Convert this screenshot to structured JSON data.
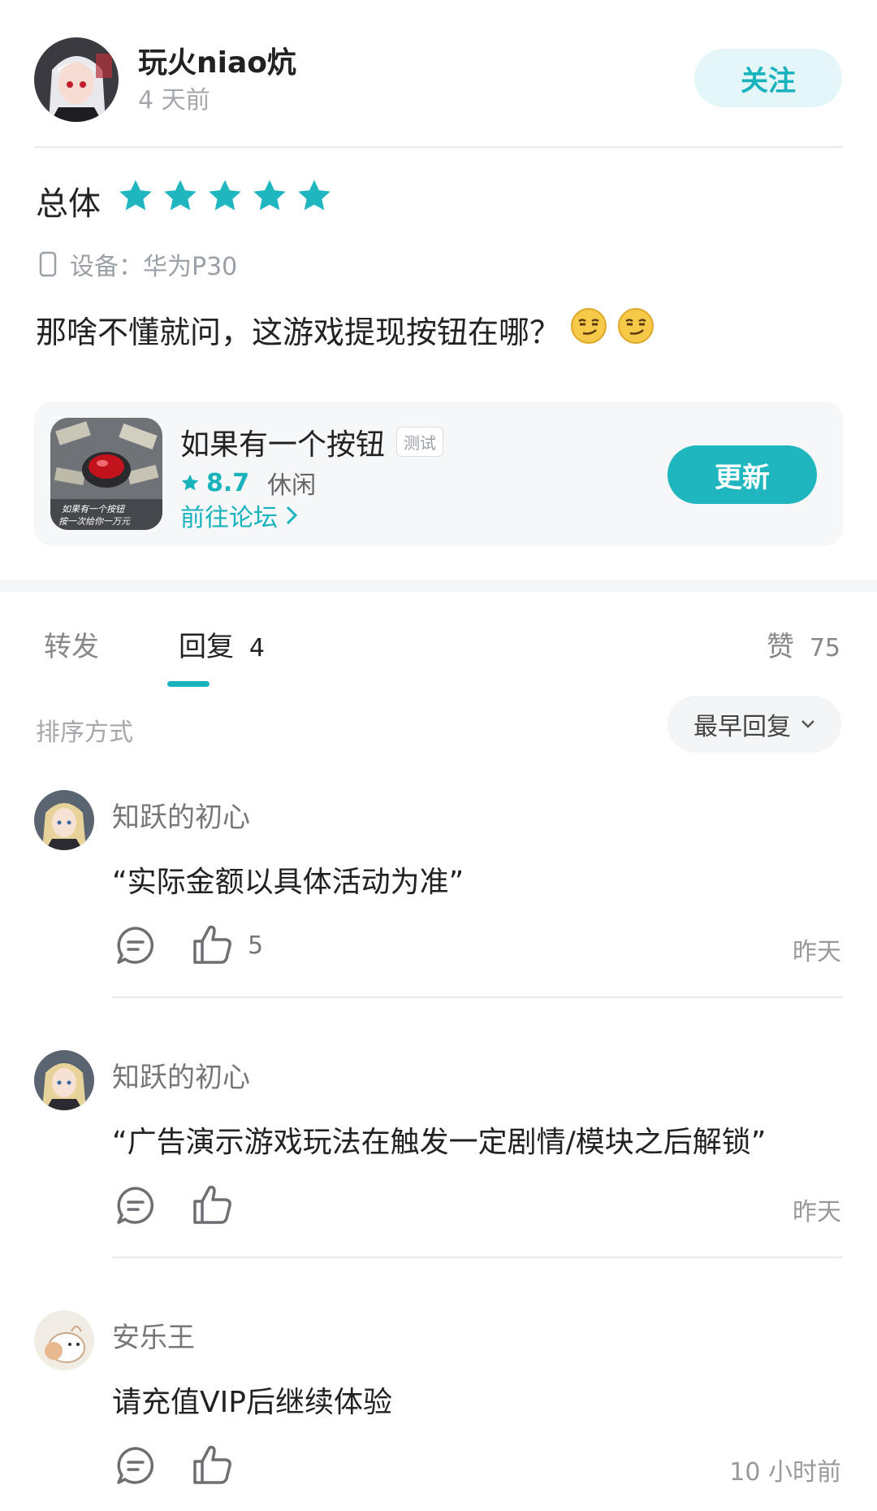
{
  "post": {
    "user_name": "玩火niao炕",
    "time": "4 天前",
    "follow_label": "关注",
    "rating_label": "总体",
    "rating_stars": 5,
    "device_label": "设备：华为P30",
    "content": "那啥不懂就问，这游戏提现按钮在哪？",
    "emoji": [
      "smirk-emoji",
      "smirk-emoji"
    ]
  },
  "app": {
    "name": "如果有一个按钮",
    "tag": "测试",
    "score": "8.7",
    "genre": "休闲",
    "forum_link": "前往论坛",
    "update_label": "更新",
    "icon_caption_1": "如果有一个按钮",
    "icon_caption_2": "按一次给你一万元"
  },
  "tabs": {
    "repost": "转发",
    "reply": "回复",
    "reply_count": "4",
    "like_label": "赞",
    "like_count": "75"
  },
  "sort": {
    "label": "排序方式",
    "selected": "最早回复"
  },
  "comments": [
    {
      "name": "知跃的初心",
      "text": "“实际金额以具体活动为准”",
      "likes": "5",
      "time": "昨天"
    },
    {
      "name": "知跃的初心",
      "text": "“广告演示游戏玩法在触发一定剧情/模块之后解锁”",
      "likes": "",
      "time": "昨天"
    },
    {
      "name": "安乐王",
      "text": "请充值VIP后继续体验",
      "likes": "",
      "time": "10 小时前"
    }
  ],
  "colors": {
    "accent": "#19b3bd",
    "accent_button": "#1fb6c0",
    "follow_bg": "#e5f6f8",
    "card_bg": "#f5f7f8"
  }
}
